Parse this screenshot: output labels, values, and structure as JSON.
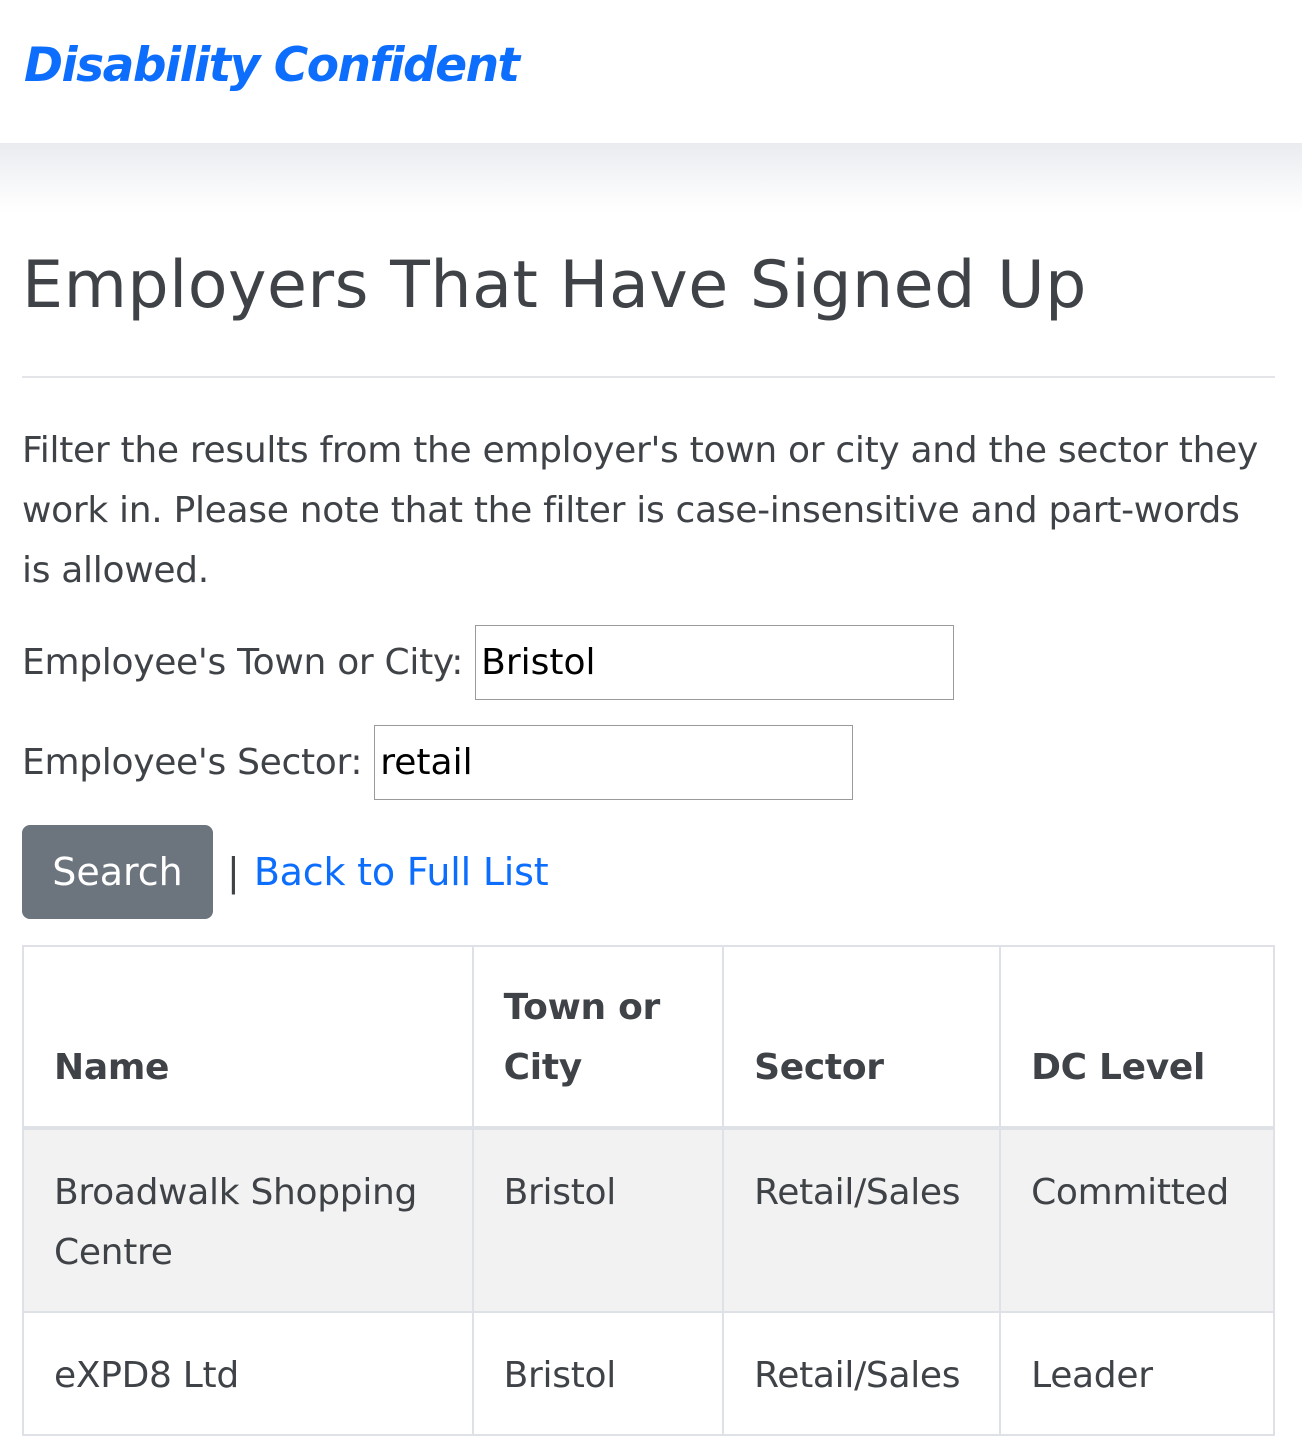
{
  "header": {
    "brand": "Disability Confident"
  },
  "page": {
    "title": "Employers That Have Signed Up",
    "intro": "Filter the results from the employer's town or city and the sector they work in. Please note that the filter is case-insensitive and part-words is allowed."
  },
  "filters": {
    "town_label": "Employee's Town or City:",
    "town_value": "Bristol",
    "sector_label": "Employee's Sector:",
    "sector_value": "retail",
    "search_label": "Search",
    "separator": "|",
    "back_label": "Back to Full List"
  },
  "table": {
    "headers": {
      "name": "Name",
      "town_line1": "Town or",
      "town_line2": "City",
      "sector": "Sector",
      "level": "DC Level"
    },
    "rows": [
      {
        "name": "Broadwalk Shopping Centre",
        "town": "Bristol",
        "sector": "Retail/Sales",
        "level": "Committed"
      },
      {
        "name": "eXPD8 Ltd",
        "town": "Bristol",
        "sector": "Retail/Sales",
        "level": "Leader"
      }
    ]
  },
  "colors": {
    "brand": "#0d6efd",
    "link": "#0d6efd",
    "button_bg": "#6c757d",
    "text": "#3f4347",
    "striped_row": "#f2f2f2"
  }
}
